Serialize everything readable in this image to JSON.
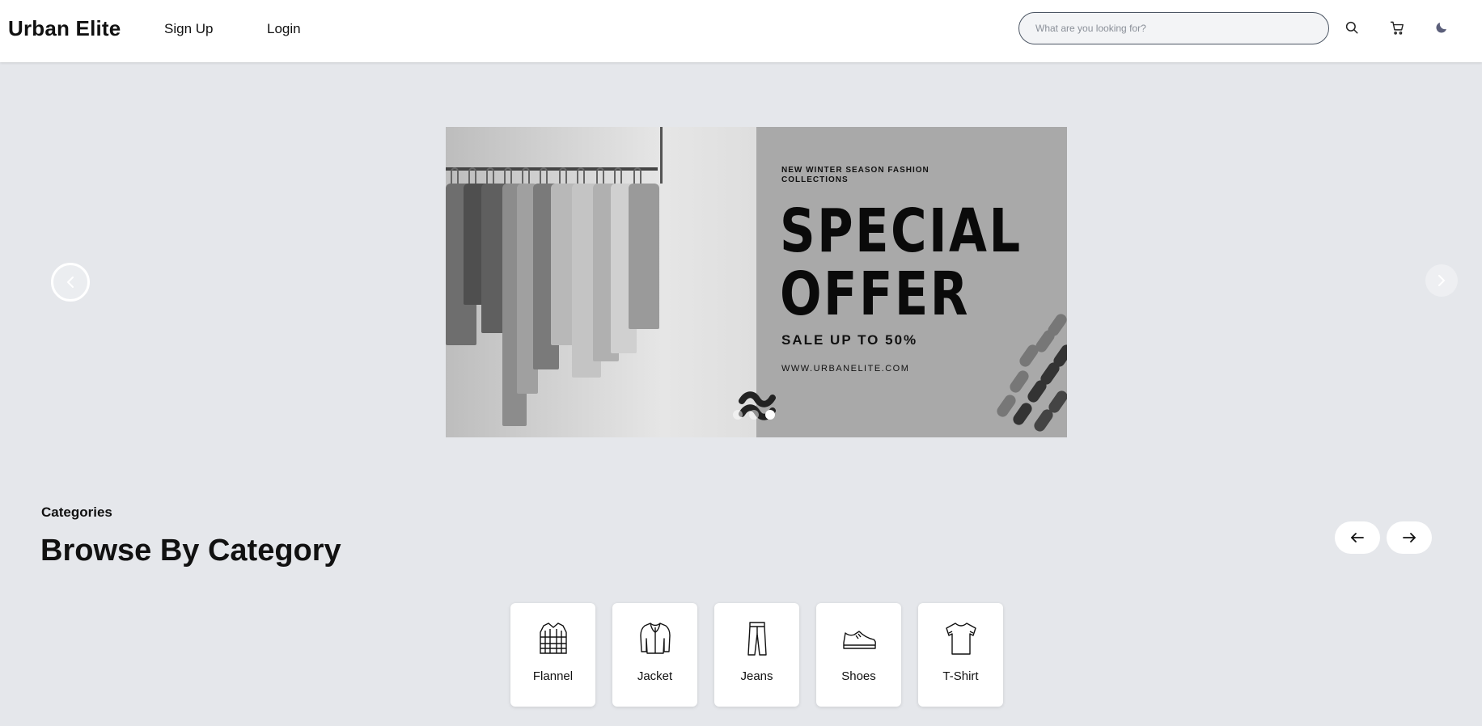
{
  "header": {
    "brand": "Urban Elite",
    "nav": {
      "signup": "Sign Up",
      "login": "Login"
    },
    "search": {
      "placeholder": "What are you looking for?",
      "value": ""
    },
    "icons": [
      "search-icon",
      "cart-icon",
      "moon-icon"
    ]
  },
  "carousel": {
    "banner": {
      "kicker": "NEW WINTER SEASON FASHION COLLECTIONS",
      "headline_line1": "SPECIAL",
      "headline_line2": "OFFER",
      "sale": "SALE UP TO 50%",
      "website": "WWW.URBANELITE.COM"
    },
    "slide_count": 3,
    "active_slide": 3
  },
  "categories": {
    "eyebrow": "Categories",
    "title": "Browse By Category",
    "items": [
      {
        "label": "Flannel",
        "icon": "flannel-shirt-icon"
      },
      {
        "label": "Jacket",
        "icon": "jacket-icon"
      },
      {
        "label": "Jeans",
        "icon": "jeans-icon"
      },
      {
        "label": "Shoes",
        "icon": "shoe-icon"
      },
      {
        "label": "T-Shirt",
        "icon": "tshirt-icon"
      }
    ]
  },
  "colors": {
    "page_bg": "#e5e7eb",
    "header_bg": "#ffffff",
    "banner_bg": "#a9a9a9",
    "text": "#111111"
  }
}
